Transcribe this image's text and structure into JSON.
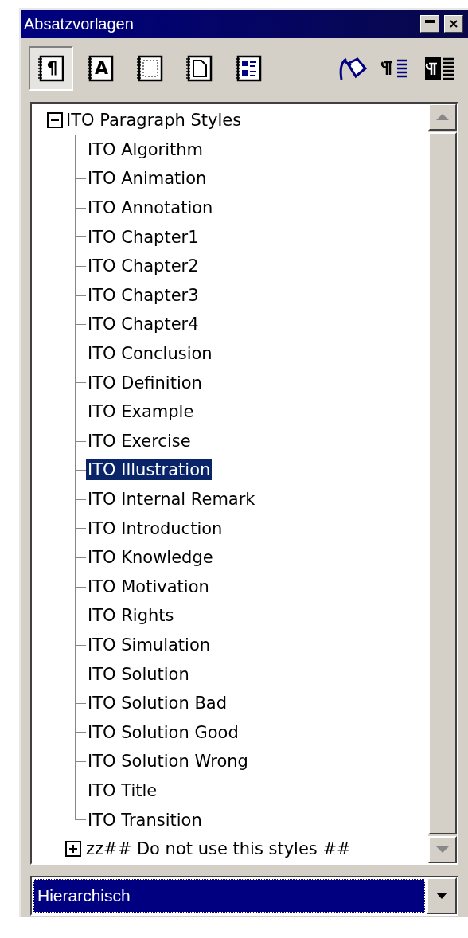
{
  "window": {
    "title": "Absatzvorlagen"
  },
  "style_families": [
    {
      "glyph": "¶",
      "selected": true
    },
    {
      "glyph": "A",
      "selected": false
    },
    {
      "selected": false
    },
    {
      "selected": false
    },
    {
      "selected": false
    }
  ],
  "tree": [
    {
      "label": "ITO Paragraph Styles",
      "expanded": true,
      "children": [
        {
          "label": "ITO Algorithm",
          "selected": false
        },
        {
          "label": "ITO Animation",
          "selected": false
        },
        {
          "label": "ITO Annotation",
          "selected": false
        },
        {
          "label": "ITO Chapter1",
          "selected": false
        },
        {
          "label": "ITO Chapter2",
          "selected": false
        },
        {
          "label": "ITO Chapter3",
          "selected": false
        },
        {
          "label": "ITO Chapter4",
          "selected": false
        },
        {
          "label": "ITO Conclusion",
          "selected": false
        },
        {
          "label": "ITO Definition",
          "selected": false
        },
        {
          "label": "ITO Example",
          "selected": false
        },
        {
          "label": "ITO Exercise",
          "selected": false
        },
        {
          "label": "ITO Illustration",
          "selected": true
        },
        {
          "label": "ITO Internal Remark",
          "selected": false
        },
        {
          "label": "ITO Introduction",
          "selected": false
        },
        {
          "label": "ITO Knowledge",
          "selected": false
        },
        {
          "label": "ITO Motivation",
          "selected": false
        },
        {
          "label": "ITO Rights",
          "selected": false
        },
        {
          "label": "ITO Simulation",
          "selected": false
        },
        {
          "label": "ITO Solution",
          "selected": false
        },
        {
          "label": "ITO Solution Bad",
          "selected": false
        },
        {
          "label": "ITO Solution Good",
          "selected": false
        },
        {
          "label": "ITO Solution Wrong",
          "selected": false
        },
        {
          "label": "ITO Title",
          "selected": false
        },
        {
          "label": "ITO Transition",
          "selected": false
        },
        {
          "label": "zz## Do not use this styles ##",
          "expanded": false,
          "selected": false
        }
      ]
    }
  ],
  "filter": {
    "value": "Hierarchisch"
  }
}
